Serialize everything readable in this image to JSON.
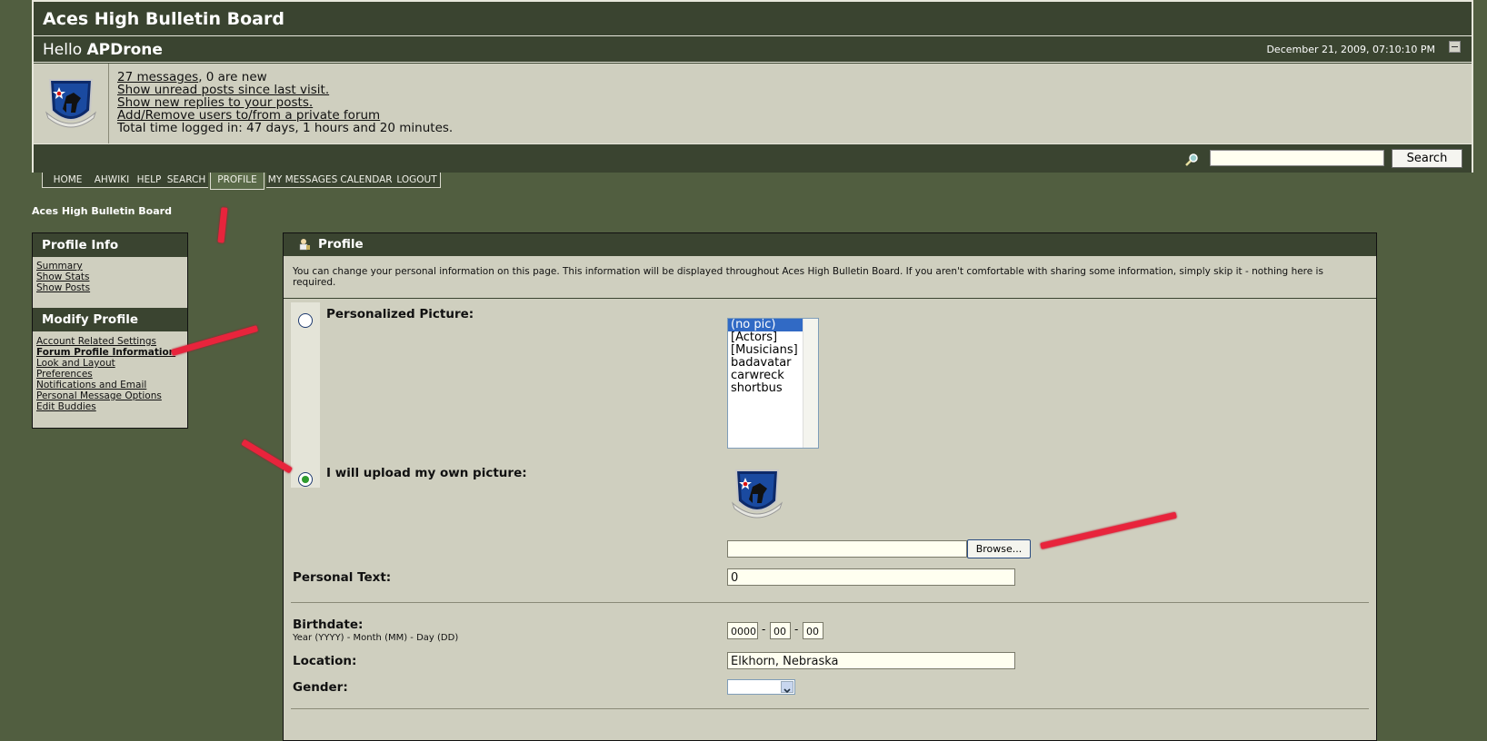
{
  "header": {
    "board_title": "Aces High Bulletin Board",
    "hello_prefix": "Hello ",
    "username": "APDrone",
    "date": "December 21, 2009, 07:10:10 PM"
  },
  "user_panel": {
    "messages_link": "27 messages",
    "messages_suffix": ", 0 are new",
    "unread_link": "Show unread posts since last visit.",
    "replies_link": "Show new replies to your posts.",
    "private_link": "Add/Remove users to/from a private forum",
    "time_logged": "Total time logged in: 47 days, 1 hours and 20 minutes."
  },
  "search": {
    "button_label": "Search",
    "value": ""
  },
  "nav": {
    "tabs": [
      "HOME",
      "AHWIKI",
      "HELP",
      "SEARCH",
      "PROFILE",
      "MY MESSAGES",
      "CALENDAR",
      "LOGOUT"
    ],
    "active": "PROFILE"
  },
  "breadcrumb": "Aces High Bulletin Board",
  "sidebar": {
    "profile_info_title": "Profile Info",
    "profile_info_links": [
      "Summary",
      "Show Stats",
      "Show Posts"
    ],
    "modify_profile_title": "Modify Profile",
    "modify_links": [
      "Account Related Settings",
      "Forum Profile Information",
      "Look and Layout",
      "Preferences",
      "Notifications and Email",
      "Personal Message Options",
      "Edit Buddies"
    ],
    "current_link": "Forum Profile Information"
  },
  "main": {
    "title": "Profile",
    "intro": "You can change your personal information on this page. This information will be displayed throughout Aces High Bulletin Board. If you aren't comfortable with sharing some information, simply skip it - nothing here is required.",
    "personalized_picture_label": "Personalized Picture:",
    "picture_options": [
      "(no pic)",
      "[Actors]",
      "[Musicians]",
      "badavatar",
      "carwreck",
      "shortbus"
    ],
    "picture_selected": "(no pic)",
    "upload_label": "I will upload my own picture:",
    "upload_selected": true,
    "upload_value": "",
    "browse_label": "Browse...",
    "personal_text_label": "Personal Text:",
    "personal_text_value": "0",
    "birthdate_label": "Birthdate:",
    "birthdate_hint": "Year (YYYY) - Month (MM) - Day (DD)",
    "birth_year": "0000",
    "birth_month": "00",
    "birth_day": "00",
    "date_separator": "-",
    "location_label": "Location:",
    "location_value": "Elkhorn, Nebraska",
    "gender_label": "Gender:",
    "gender_value": ""
  },
  "colors": {
    "page_bg": "#515e40",
    "header_bg": "#3a4430",
    "panel_bg": "#cfcfbf",
    "annotation_red": "#e8243c",
    "selected_option": "#316ac5"
  },
  "icons": [
    "avatar-emblem",
    "search-icon",
    "profile-icon",
    "collapse-icon"
  ]
}
